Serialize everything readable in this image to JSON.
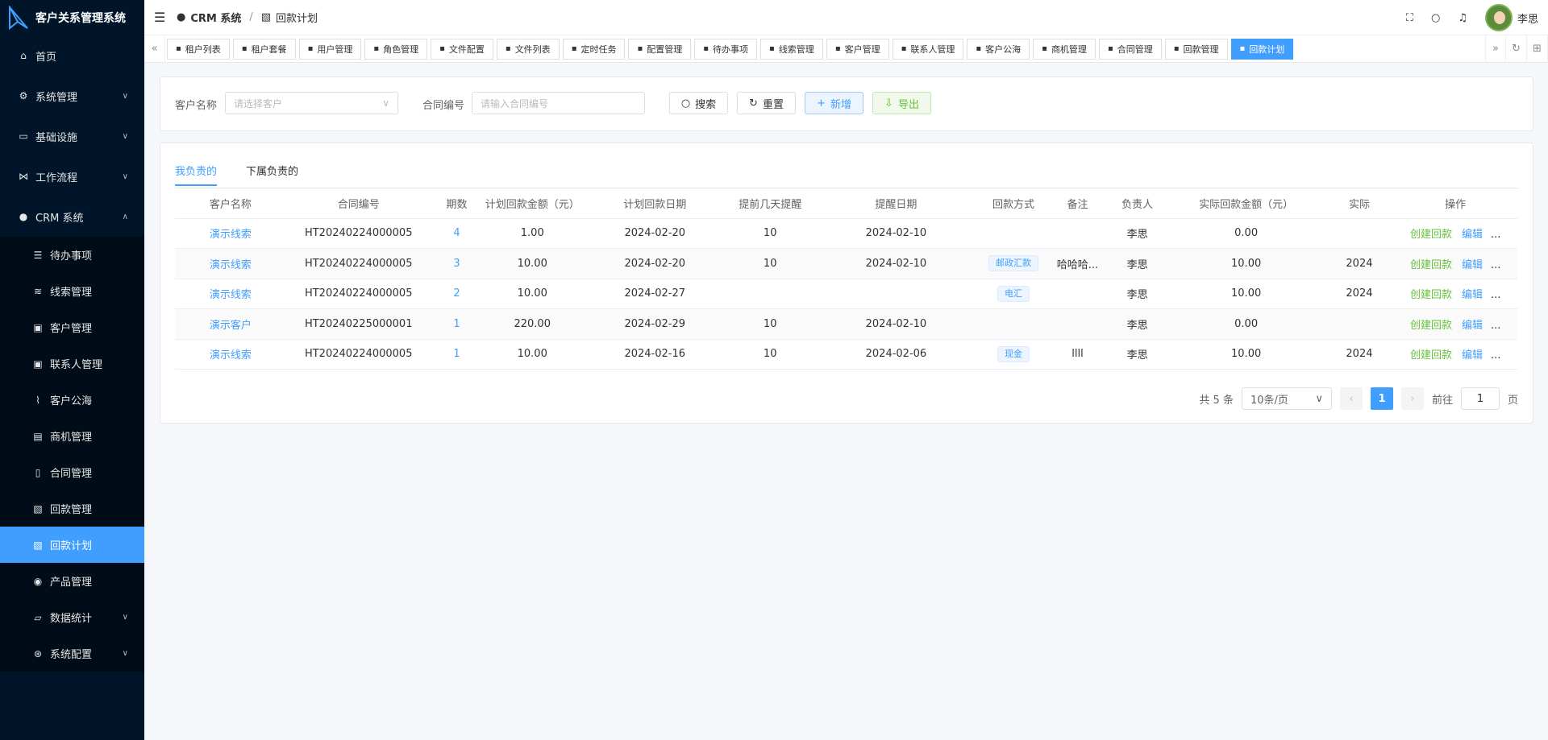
{
  "app": {
    "title": "客户关系管理系统"
  },
  "sidebar": {
    "items": [
      {
        "label": "首页",
        "icon": "home-icon"
      },
      {
        "label": "系统管理",
        "icon": "gear-icon"
      },
      {
        "label": "基础设施",
        "icon": "monitor-icon"
      },
      {
        "label": "工作流程",
        "icon": "workflow-icon"
      },
      {
        "label": "CRM 系统",
        "icon": "user-icon"
      }
    ],
    "crm_sub": [
      {
        "label": "待办事项"
      },
      {
        "label": "线索管理"
      },
      {
        "label": "客户管理"
      },
      {
        "label": "联系人管理"
      },
      {
        "label": "客户公海"
      },
      {
        "label": "商机管理"
      },
      {
        "label": "合同管理"
      },
      {
        "label": "回款管理"
      },
      {
        "label": "回款计划"
      },
      {
        "label": "产品管理"
      },
      {
        "label": "数据统计"
      },
      {
        "label": "系统配置"
      }
    ]
  },
  "header": {
    "breadcrumb": [
      "CRM 系统",
      "回款计划"
    ],
    "user_name": "李思"
  },
  "tags": [
    "租户列表",
    "租户套餐",
    "用户管理",
    "角色管理",
    "文件配置",
    "文件列表",
    "定时任务",
    "配置管理",
    "待办事项",
    "线索管理",
    "客户管理",
    "联系人管理",
    "客户公海",
    "商机管理",
    "合同管理",
    "回款管理",
    "回款计划"
  ],
  "search": {
    "customer_label": "客户名称",
    "customer_placeholder": "请选择客户",
    "contract_label": "合同编号",
    "contract_placeholder": "请输入合同编号",
    "search_btn": "搜索",
    "reset_btn": "重置",
    "add_btn": "新增",
    "export_btn": "导出"
  },
  "tabs": [
    "我负责的",
    "下属负责的"
  ],
  "table": {
    "columns": [
      "客户名称",
      "合同编号",
      "期数",
      "计划回款金额（元）",
      "计划回款日期",
      "提前几天提醒",
      "提醒日期",
      "回款方式",
      "备注",
      "负责人",
      "实际回款金额（元）",
      "实际",
      "操作"
    ],
    "rows": [
      {
        "customer": "演示线索",
        "contract": "HT20240224000005",
        "period": "4",
        "amount": "1.00",
        "date": "2024-02-20",
        "remind_days": "10",
        "remind_date": "2024-02-10",
        "method": "",
        "note": "",
        "owner": "李思",
        "actual": "0.00",
        "actual_date": ""
      },
      {
        "customer": "演示线索",
        "contract": "HT20240224000005",
        "period": "3",
        "amount": "10.00",
        "date": "2024-02-20",
        "remind_days": "10",
        "remind_date": "2024-02-10",
        "method": "邮政汇款",
        "note": "哈哈哈...",
        "owner": "李思",
        "actual": "10.00",
        "actual_date": "2024"
      },
      {
        "customer": "演示线索",
        "contract": "HT20240224000005",
        "period": "2",
        "amount": "10.00",
        "date": "2024-02-27",
        "remind_days": "",
        "remind_date": "",
        "method": "电汇",
        "note": "",
        "owner": "李思",
        "actual": "10.00",
        "actual_date": "2024"
      },
      {
        "customer": "演示客户",
        "contract": "HT20240225000001",
        "period": "1",
        "amount": "220.00",
        "date": "2024-02-29",
        "remind_days": "10",
        "remind_date": "2024-02-10",
        "method": "",
        "note": "",
        "owner": "李思",
        "actual": "0.00",
        "actual_date": ""
      },
      {
        "customer": "演示线索",
        "contract": "HT20240224000005",
        "period": "1",
        "amount": "10.00",
        "date": "2024-02-16",
        "remind_days": "10",
        "remind_date": "2024-02-06",
        "method": "现金",
        "note": "llll",
        "owner": "李思",
        "actual": "10.00",
        "actual_date": "2024"
      }
    ],
    "ops": {
      "create": "创建回款",
      "edit": "编辑",
      "more": "..."
    }
  },
  "pager": {
    "total": "共 5 条",
    "page_size": "10条/页",
    "current": "1",
    "goto_label": "前往",
    "goto_value": "1",
    "page_unit": "页"
  }
}
